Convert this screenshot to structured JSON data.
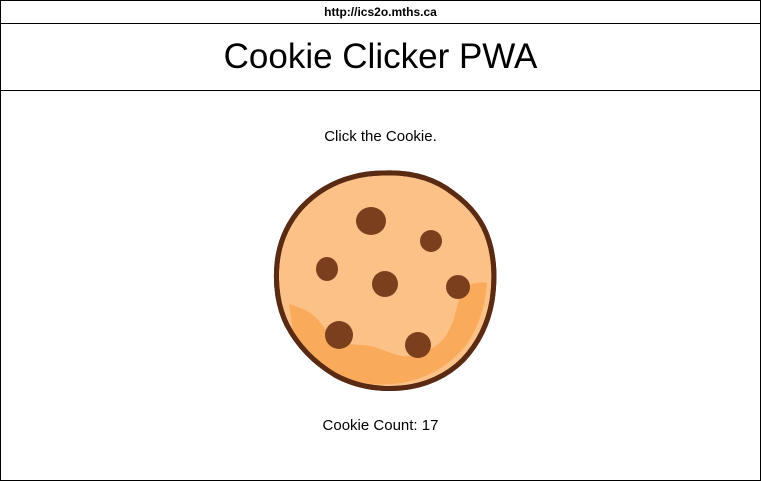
{
  "browser": {
    "url": "http://ics2o.mths.ca"
  },
  "header": {
    "title": "Cookie Clicker PWA"
  },
  "main": {
    "instruction": "Click the Cookie.",
    "counter_label": "Cookie Count: ",
    "counter_value": 17,
    "cookie_icon": "cookie-icon"
  },
  "colors": {
    "cookie_dough": "#FBC187",
    "cookie_shadow": "#F8A857",
    "cookie_outline": "#5A2A12",
    "chocolate_chip": "#7B3F1E"
  }
}
